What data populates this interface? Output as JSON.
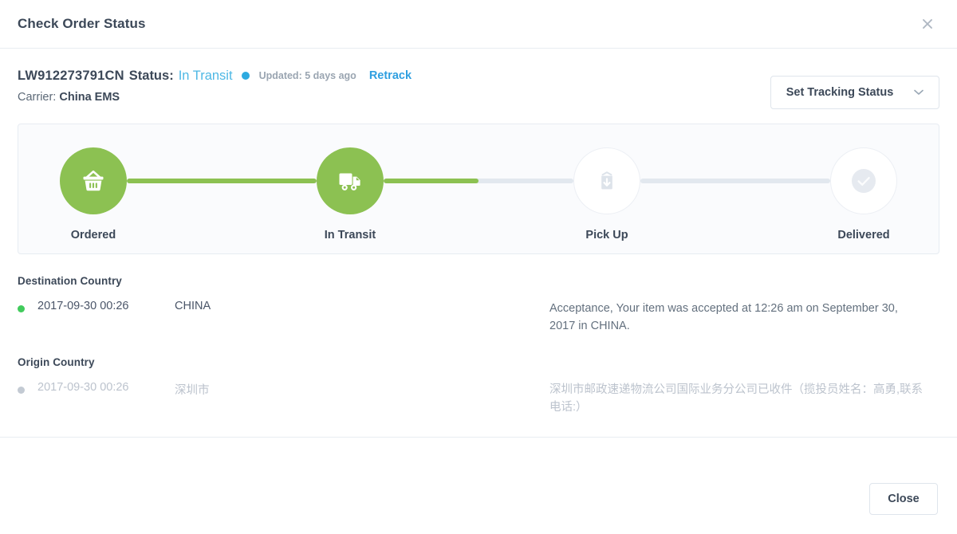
{
  "header": {
    "title": "Check Order Status",
    "close_icon": "close-icon"
  },
  "status": {
    "tracking_number": "LW912273791CN",
    "status_label": "Status:",
    "status_value": "In Transit",
    "status_dot_color": "#2eaae0",
    "updated_text": "Updated: 5 days ago",
    "retrack_label": "Retrack",
    "carrier_label": "Carrier:",
    "carrier_name": "China EMS",
    "set_tracking_status_label": "Set Tracking Status",
    "caret_icon": "chevron-down-icon"
  },
  "progress": {
    "active_color": "#8cc152",
    "inactive_color": "#e2e8ef",
    "steps": [
      {
        "label": "Ordered",
        "icon": "shopping-basket-icon",
        "state": "done"
      },
      {
        "label": "In Transit",
        "icon": "delivery-truck-icon",
        "state": "done"
      },
      {
        "label": "Pick Up",
        "icon": "package-download-icon",
        "state": "todo"
      },
      {
        "label": "Delivered",
        "icon": "check-circle-icon",
        "state": "todo"
      }
    ],
    "connectors": [
      {
        "fill_percent": 100
      },
      {
        "fill_percent": 50
      },
      {
        "fill_percent": 0
      }
    ]
  },
  "destination": {
    "section_title": "Destination Country",
    "events": [
      {
        "dot": "active",
        "date": "2017-09-30 00:26",
        "place": "CHINA",
        "description": "Acceptance, Your item was accepted at 12:26 am on September 30, 2017 in CHINA."
      }
    ]
  },
  "origin": {
    "section_title": "Origin Country",
    "events": [
      {
        "dot": "muted",
        "date": "2017-09-30 00:26",
        "place": "深圳市",
        "description": "深圳市邮政速递物流公司国际业务分公司已收件（揽投员姓名：高勇,联系电话:）"
      }
    ]
  },
  "footer": {
    "close_label": "Close"
  }
}
